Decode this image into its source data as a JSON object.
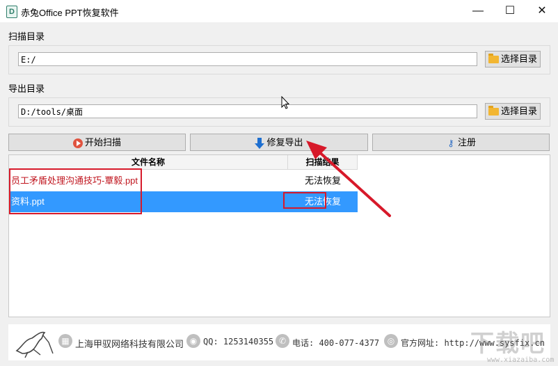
{
  "window": {
    "title": "赤兔Office PPT恢复软件"
  },
  "window_controls": {
    "minimize": "—",
    "maximize": "☐",
    "close": "✕"
  },
  "scan_dir": {
    "label": "扫描目录",
    "value": "E:/",
    "browse_label": "选择目录"
  },
  "export_dir": {
    "label": "导出目录",
    "value": "D:/tools/桌面",
    "browse_label": "选择目录"
  },
  "actions": {
    "start_scan": "开始扫描",
    "repair_export": "修复导出",
    "register": "注册"
  },
  "table": {
    "headers": [
      "文件名称",
      "扫描结果"
    ],
    "rows": [
      {
        "name": "员工矛盾处理沟通技巧-覃毅.ppt",
        "result": "无法恢复",
        "selected": false
      },
      {
        "name": "资料.ppt",
        "result": "无法恢复",
        "selected": true
      }
    ]
  },
  "footer": {
    "company": "上海甲驭网络科技有限公司",
    "qq": "QQ: 1253140355",
    "phone": "电话: 400-077-4377",
    "website": "官方网址: http://www.sysfix.cn"
  },
  "watermark": {
    "text": "下载吧",
    "url": "www.xiazaiba.com"
  },
  "colors": {
    "accent": "#3399ff",
    "highlight": "#d7192a",
    "arrow": "#d7192a"
  }
}
